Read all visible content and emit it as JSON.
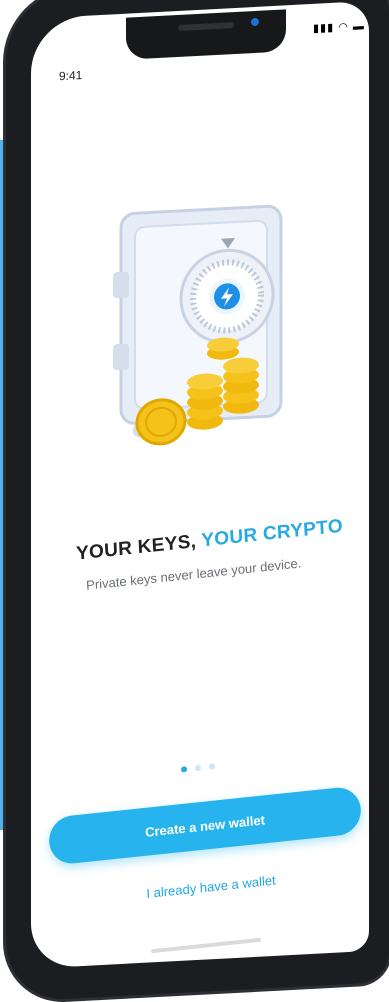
{
  "status_bar": {
    "time": "9:41",
    "signal_icon": "signal-bars-icon",
    "wifi_icon": "wifi-icon",
    "battery_icon": "battery-icon"
  },
  "onboarding": {
    "title_prefix": "YOUR KEYS, ",
    "title_accent": "YOUR CRYPTO",
    "subtitle": "Private keys never leave your device.",
    "pagination": {
      "total": 3,
      "active_index": 0
    },
    "primary_button": "Create a new wallet",
    "secondary_link": "I already have a wallet"
  },
  "colors": {
    "accent": "#27a9e1",
    "button": "#27b4ee",
    "side_panel": "#4db3ea",
    "coin": "#f5c21b"
  },
  "illustration_icons": [
    "safe-icon",
    "lightning-bolt-icon",
    "gold-coins-icon"
  ]
}
